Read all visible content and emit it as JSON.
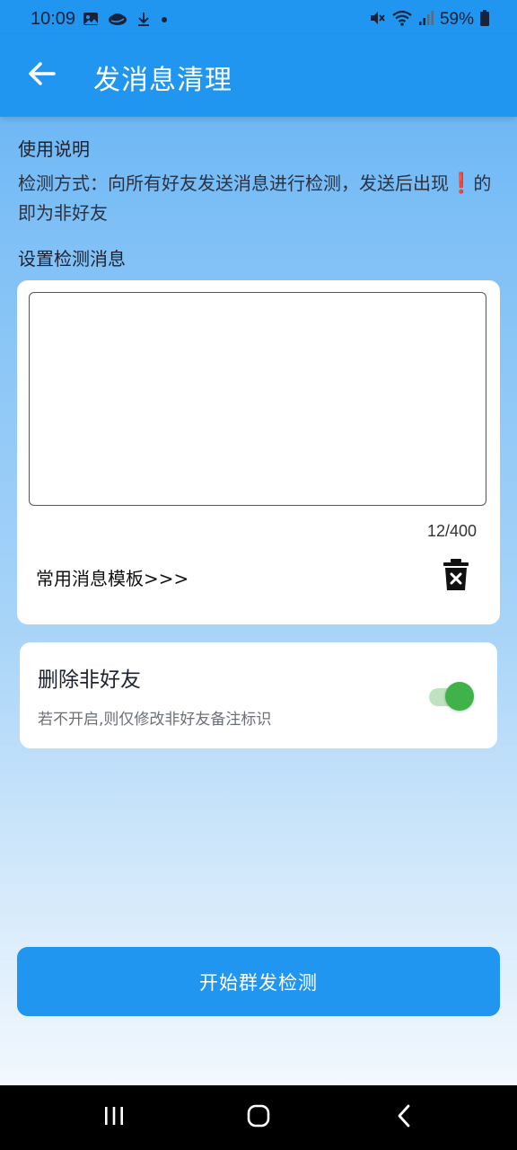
{
  "status_bar": {
    "time": "10:09",
    "battery": "59%",
    "icons_left": [
      "image-icon",
      "cloud-icon",
      "download-icon",
      "dot-icon"
    ],
    "icons_right": [
      "mute-icon",
      "wifi-icon",
      "signal-icon",
      "battery-icon"
    ]
  },
  "app_bar": {
    "title": "发消息清理",
    "back_icon": "arrow-left-icon"
  },
  "instructions": {
    "heading": "使用说明",
    "text_part1": "检测方式：向所有好友发送消息进行检测，发送后出现",
    "exclaim": "❗",
    "text_part2": "的即为非好友"
  },
  "message_settings": {
    "heading": "设置检测消息",
    "textarea_value": "",
    "char_count": "12/400",
    "templates_link": "常用消息模板>>>",
    "trash_icon": "trash-icon"
  },
  "delete_option": {
    "title": "删除非好友",
    "subtitle": "若不开启,则仅修改非好友备注标识",
    "enabled": true
  },
  "actions": {
    "start_label": "开始群发检测"
  },
  "nav": {
    "recents": "recents-icon",
    "home": "home-icon",
    "back": "back-icon"
  },
  "colors": {
    "primary": "#2196f0",
    "toggle_on": "#3fb24a",
    "exclaim": "#e5232c"
  }
}
